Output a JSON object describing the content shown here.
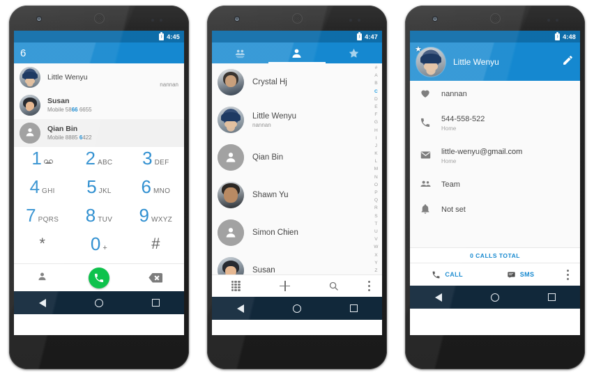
{
  "phone1": {
    "status": {
      "time": "4:45",
      "battery_icon": "battery-icon"
    },
    "dialer": {
      "entered_number": "6"
    },
    "suggestions": [
      {
        "name": "Little Wenyu",
        "sub": "",
        "right": "nannan",
        "avatar": "photo-wenyu",
        "bold": false
      },
      {
        "name": "Susan",
        "sub_prefix": "Mobile 58",
        "sub_hl": "66",
        "sub_suffix": " 6655",
        "avatar": "photo-susan",
        "bold": true
      },
      {
        "name": "Qian Bin",
        "sub_prefix": "Mobile 8885 ",
        "sub_hl": "6",
        "sub_suffix": "422",
        "avatar": "generic-person",
        "bold": true
      }
    ],
    "keypad": [
      [
        {
          "digit": "1",
          "letters": "voicemail-icon"
        },
        {
          "digit": "2",
          "letters": "ABC"
        },
        {
          "digit": "3",
          "letters": "DEF"
        }
      ],
      [
        {
          "digit": "4",
          "letters": "GHI"
        },
        {
          "digit": "5",
          "letters": "JKL"
        },
        {
          "digit": "6",
          "letters": "MNO"
        }
      ],
      [
        {
          "digit": "7",
          "letters": "PQRS"
        },
        {
          "digit": "8",
          "letters": "TUV"
        },
        {
          "digit": "9",
          "letters": "WXYZ"
        }
      ],
      [
        {
          "digit": "*",
          "letters": ""
        },
        {
          "digit": "0",
          "letters": "+"
        },
        {
          "digit": "#",
          "letters": ""
        }
      ]
    ],
    "actions": {
      "contacts_icon": "person-icon",
      "call_icon": "phone-icon",
      "delete_icon": "backspace-icon"
    }
  },
  "phone2": {
    "status": {
      "time": "4:47",
      "battery_icon": "battery-icon"
    },
    "tabs": [
      {
        "icon": "speed-dial-group-icon",
        "active": false
      },
      {
        "icon": "person-icon",
        "active": true
      },
      {
        "icon": "star-icon",
        "active": false
      }
    ],
    "contacts": [
      {
        "name": "Crystal Hj",
        "sub": "",
        "avatar": "photo-crystal"
      },
      {
        "name": "Little Wenyu",
        "sub": "nannan",
        "avatar": "photo-wenyu"
      },
      {
        "name": "Qian Bin",
        "sub": "",
        "avatar": "generic-person"
      },
      {
        "name": "Shawn Yu",
        "sub": "",
        "avatar": "photo-shawn"
      },
      {
        "name": "Simon Chien",
        "sub": "",
        "avatar": "generic-person"
      },
      {
        "name": "Susan",
        "sub": "",
        "avatar": "photo-susan"
      }
    ],
    "index_strip": [
      "#",
      "A",
      "B",
      "C",
      "D",
      "E",
      "F",
      "G",
      "H",
      "I",
      "J",
      "K",
      "L",
      "M",
      "N",
      "O",
      "P",
      "Q",
      "R",
      "S",
      "T",
      "U",
      "V",
      "W",
      "X",
      "Y",
      "Z"
    ],
    "index_active": "C",
    "bottom_bar": [
      {
        "icon": "dialpad-icon"
      },
      {
        "icon": "add-contact-icon"
      },
      {
        "icon": "search-icon"
      },
      {
        "icon": "overflow-menu-icon"
      }
    ]
  },
  "phone3": {
    "status": {
      "time": "4:48",
      "battery_icon": "battery-icon"
    },
    "header": {
      "name": "Little Wenyu",
      "favorite_icon": "star-icon",
      "edit_icon": "pencil-icon",
      "avatar": "photo-wenyu"
    },
    "details": [
      {
        "icon": "heart-icon",
        "value": "nannan",
        "label": ""
      },
      {
        "icon": "phone-icon",
        "value": "544-558-522",
        "label": "Home"
      },
      {
        "icon": "email-icon",
        "value": "little-wenyu@gmail.com",
        "label": "Home"
      },
      {
        "icon": "group-icon",
        "value": "Team",
        "label": ""
      },
      {
        "icon": "bell-icon",
        "value": "Not set",
        "label": ""
      }
    ],
    "calls_total": "0 CALLS TOTAL",
    "actions": [
      {
        "icon": "phone-icon",
        "label": "CALL"
      },
      {
        "icon": "sms-icon",
        "label": "SMS"
      },
      {
        "icon": "overflow-menu-icon",
        "label": ""
      }
    ]
  },
  "navbar": {
    "back": "back-triangle-icon",
    "home": "home-circle-icon",
    "recents": "recents-square-icon"
  },
  "colors": {
    "primary_blue": "#1287cf",
    "status_blue": "#0b6ba8",
    "accent_blue": "#2f8fd0",
    "call_green": "#0bc14a",
    "navbar": "#0e2538",
    "list_bg": "#fafafa"
  }
}
